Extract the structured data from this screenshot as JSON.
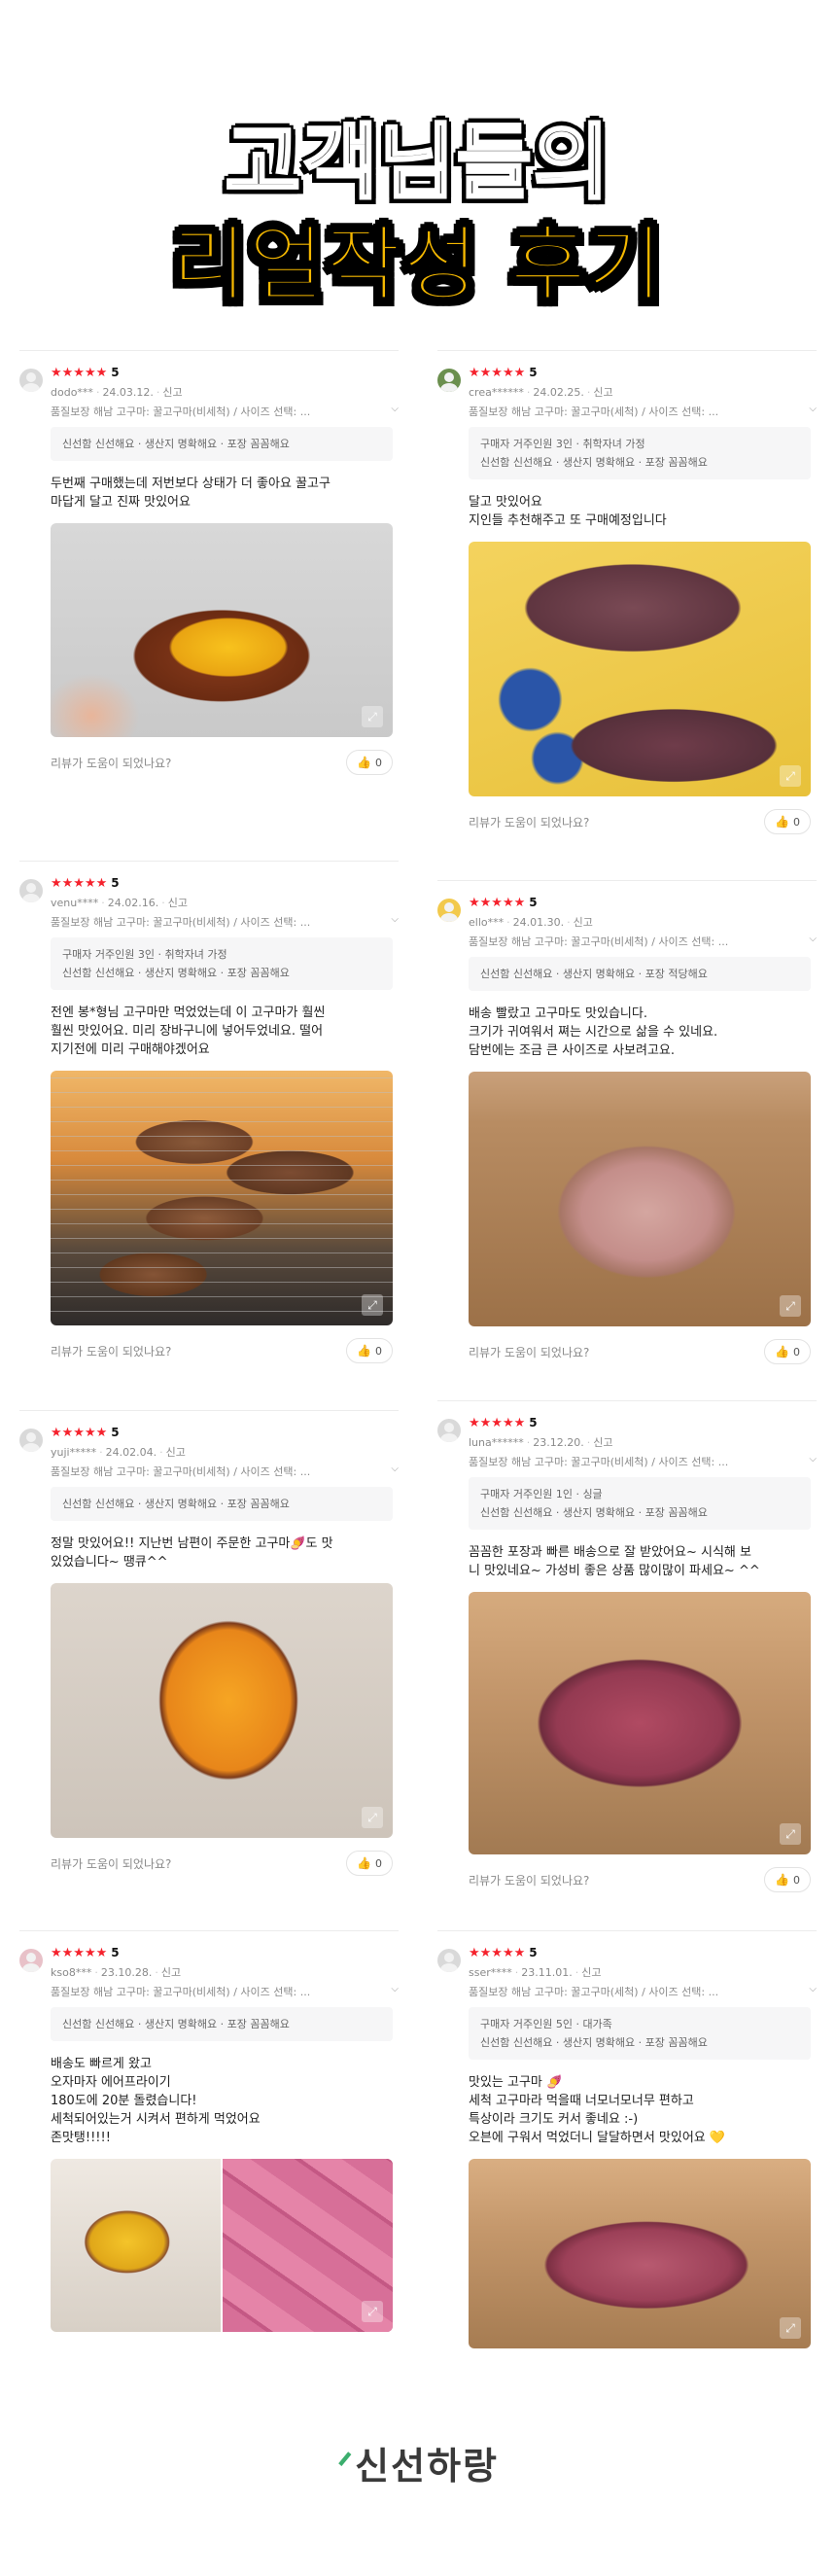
{
  "hero": {
    "line1": "고객님들의",
    "line2": "리얼작성 후기"
  },
  "common": {
    "helpful_question": "리뷰가 도움이 되었나요?",
    "report": "신고",
    "thumb_icon": "thumbs-up-icon",
    "expand_icon": "expand-icon",
    "accent_color": "#f5222d",
    "highlight_color": "#f5b800"
  },
  "reviews": [
    {
      "user": "dodo***",
      "date": "24.03.12.",
      "rating": "5",
      "stars": "★★★★★",
      "option": "품질보장 해남 고구마: 꿀고구마(비세척) / 사이즈 선택: ...",
      "buyer": "",
      "tags": "신선함 신선해요 · 생산지 명확해요 · 포장 꼼꼼해요",
      "text": "두번째 구매했는데 저번보다 상태가 더 좋아요 꿀고구\n마답게 달고 진짜 맛있어요",
      "helpful": "0"
    },
    {
      "user": "crea******",
      "date": "24.02.25.",
      "rating": "5",
      "stars": "★★★★★",
      "option": "품질보장 해남 고구마: 꿀고구마(세척) / 사이즈 선택: ...",
      "buyer": "구매자 거주인원 3인 · 취학자녀 가정",
      "tags": "신선함 신선해요 · 생산지 명확해요 · 포장 꼼꼼해요",
      "text": "달고 맛있어요\n지인들 추천해주고 또 구매예정입니다",
      "helpful": "0"
    },
    {
      "user": "venu****",
      "date": "24.02.16.",
      "rating": "5",
      "stars": "★★★★★",
      "option": "품질보장 해남 고구마: 꿀고구마(비세척) / 사이즈 선택: ...",
      "buyer": "구매자 거주인원 3인 · 취학자녀 가정",
      "tags": "신선함 신선해요 · 생산지 명확해요 · 포장 꼼꼼해요",
      "text": "전엔 봉*형님 고구마만 먹었었는데 이 고구마가 훨씬\n훨씬 맛있어요.  미리 장바구니에 넣어두었네요. 떨어\n지기전에 미리 구매해야겠어요",
      "helpful": "0"
    },
    {
      "user": "ello***",
      "date": "24.01.30.",
      "rating": "5",
      "stars": "★★★★★",
      "option": "품질보장 해남 고구마: 꿀고구마(비세척) / 사이즈 선택: ...",
      "buyer": "",
      "tags": "신선함 신선해요 · 생산지 명확해요 · 포장 적당해요",
      "text": "배송 빨랐고 고구마도 맛있습니다.\n크기가 귀여워서 쪄는 시간으로 삶을 수 있네요.\n담번에는 조금 큰 사이즈로 사보려고요.",
      "helpful": "0"
    },
    {
      "user": "yuji*****",
      "date": "24.02.04.",
      "rating": "5",
      "stars": "★★★★★",
      "option": "품질보장 해남 고구마: 꿀고구마(비세척) / 사이즈 선택: ...",
      "buyer": "",
      "tags": "신선함 신선해요 · 생산지 명확해요 · 포장 꼼꼼해요",
      "text": "정말 맛있어요!! 지난번 남편이 주문한 고구마🍠도 맛\n있었습니다~ 땡큐^^",
      "helpful": "0"
    },
    {
      "user": "luna******",
      "date": "23.12.20.",
      "rating": "5",
      "stars": "★★★★★",
      "option": "품질보장 해남 고구마: 꿀고구마(비세척) / 사이즈 선택: ...",
      "buyer": "구매자 거주인원 1인 · 싱글",
      "tags": "신선함 신선해요 · 생산지 명확해요 · 포장 꼼꼼해요",
      "text": "꼼꼼한 포장과 빠른 배송으로 잘 받았어요~ 시식해 보\n니 맛있네요~ 가성비 좋은 상품 많이많이 파세요~ ^^",
      "helpful": "0"
    },
    {
      "user": "kso8***",
      "date": "23.10.28.",
      "rating": "5",
      "stars": "★★★★★",
      "option": "품질보장 해남 고구마: 꿀고구마(비세척) / 사이즈 선택: ...",
      "buyer": "",
      "tags": "신선함 신선해요 · 생산지 명확해요 · 포장 꼼꼼해요",
      "text": "배송도 빠르게 왔고\n오자마자 에어프라이기\n180도에 20분 돌렸습니다!\n세척되어있는거 시켜서 편하게 먹었어요\n존맛탱!!!!!",
      "helpful": ""
    },
    {
      "user": "sser****",
      "date": "23.11.01.",
      "rating": "5",
      "stars": "★★★★★",
      "option": "품질보장 해남 고구마: 꿀고구마(세척) / 사이즈 선택: ...",
      "buyer": "구매자 거주인원 5인 · 대가족",
      "tags": "신선함 신선해요 · 생산지 명확해요 · 포장 꼼꼼해요",
      "text": "맛있는 고구마 🍠\n세척 고구마라 먹을때 너모너모너무 편하고\n특상이라 크기도 커서 좋네요 :-)\n오븐에 구워서 먹었더니 달달하면서 맛있어요 💛",
      "helpful": ""
    }
  ],
  "footer": {
    "logo": "신선하랑"
  }
}
